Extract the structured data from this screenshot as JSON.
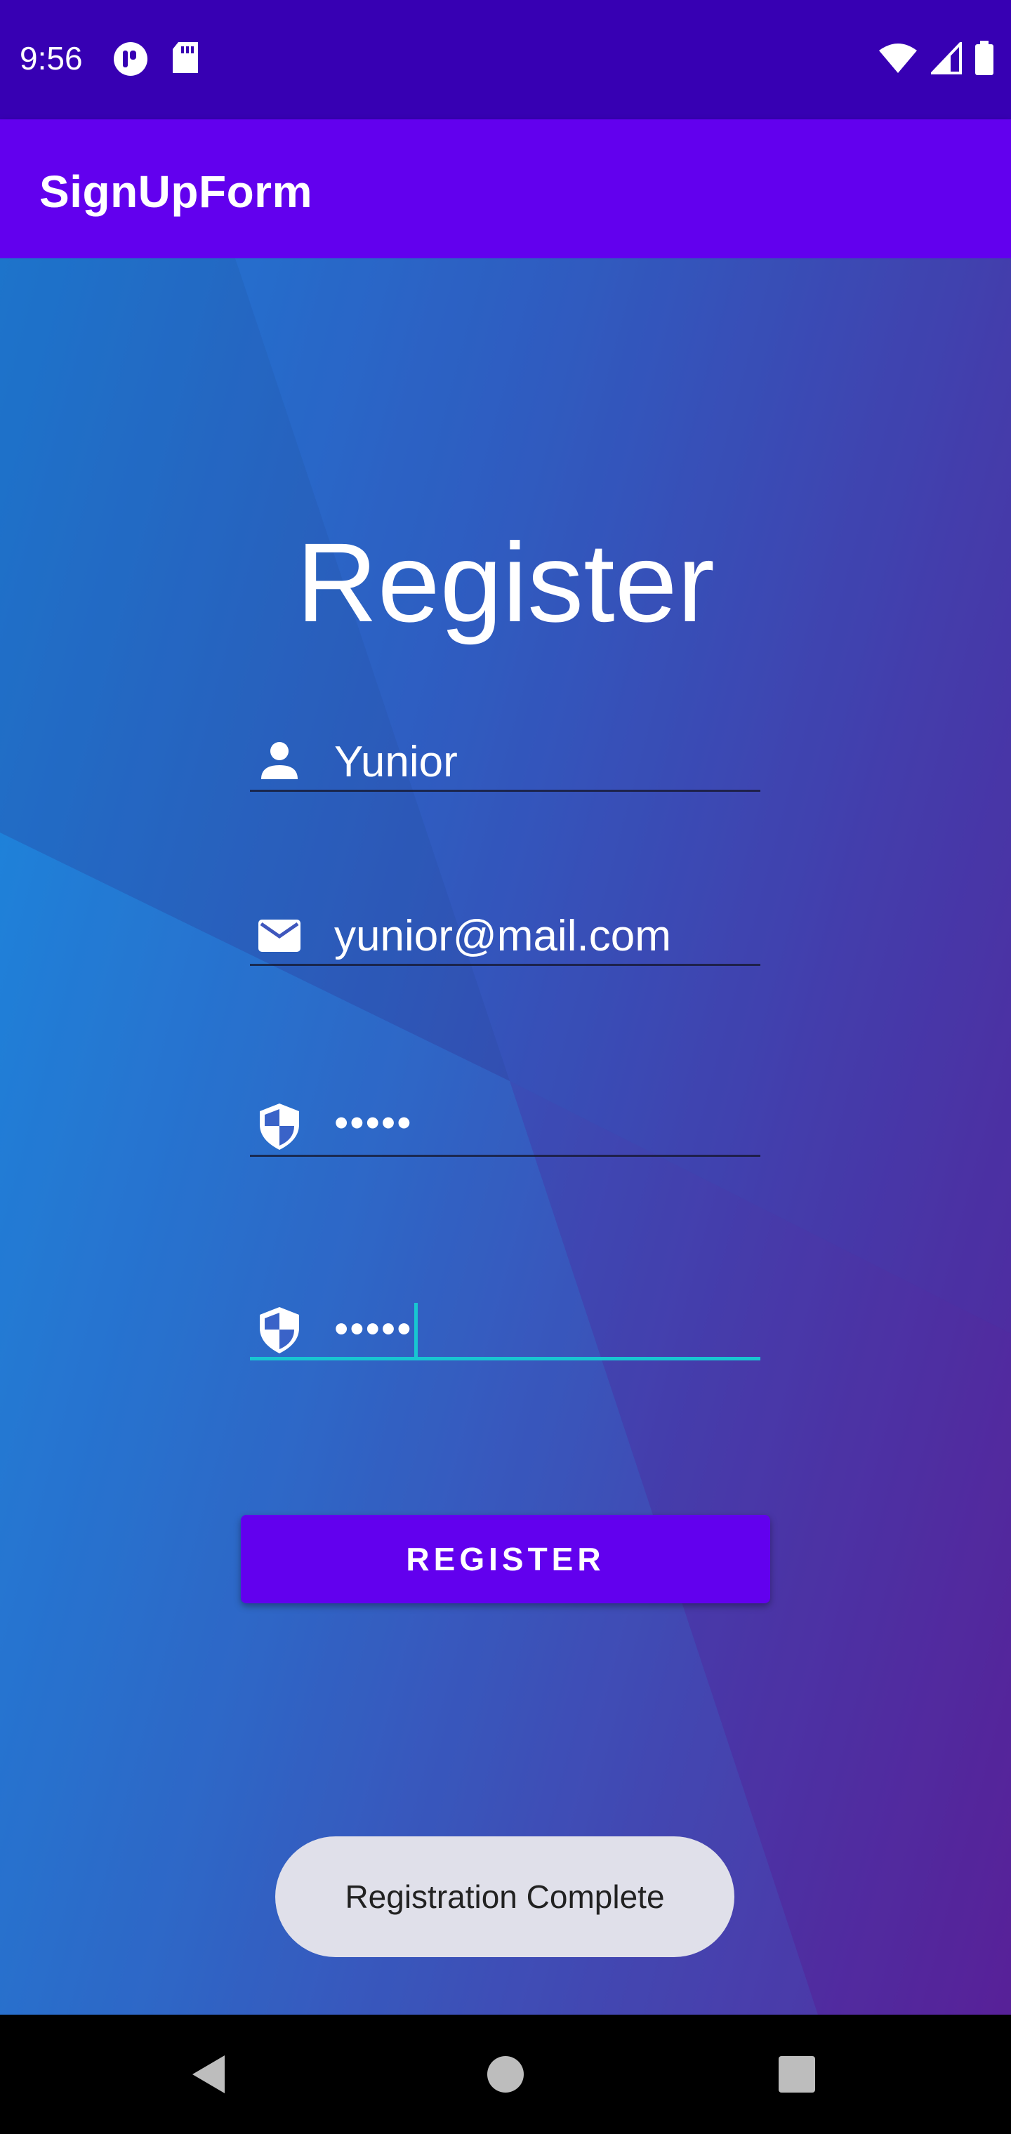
{
  "status_bar": {
    "time": "9:56",
    "left_icons": [
      "notification-icon",
      "sd-card-icon"
    ],
    "right_icons": [
      "wifi-icon",
      "signal-icon",
      "battery-icon"
    ]
  },
  "app_bar": {
    "title": "SignUpForm"
  },
  "form": {
    "heading": "Register",
    "fields": [
      {
        "icon": "person-icon",
        "value": "Yunior"
      },
      {
        "icon": "mail-icon",
        "value": "yunior@mail.com"
      },
      {
        "icon": "shield-icon",
        "value": "•••••"
      },
      {
        "icon": "shield-icon",
        "value": "•••••",
        "focused": true
      }
    ],
    "submit_label": "REGISTER"
  },
  "toast": {
    "message": "Registration Complete"
  },
  "colors": {
    "status_bar": "#3700b3",
    "app_bar": "#6200ee",
    "button": "#6200ee",
    "focus_accent": "#18c6d1",
    "toast_bg": "#e0e0ea"
  },
  "nav_bar": {
    "buttons": [
      "back-icon",
      "home-icon",
      "recents-icon"
    ]
  }
}
